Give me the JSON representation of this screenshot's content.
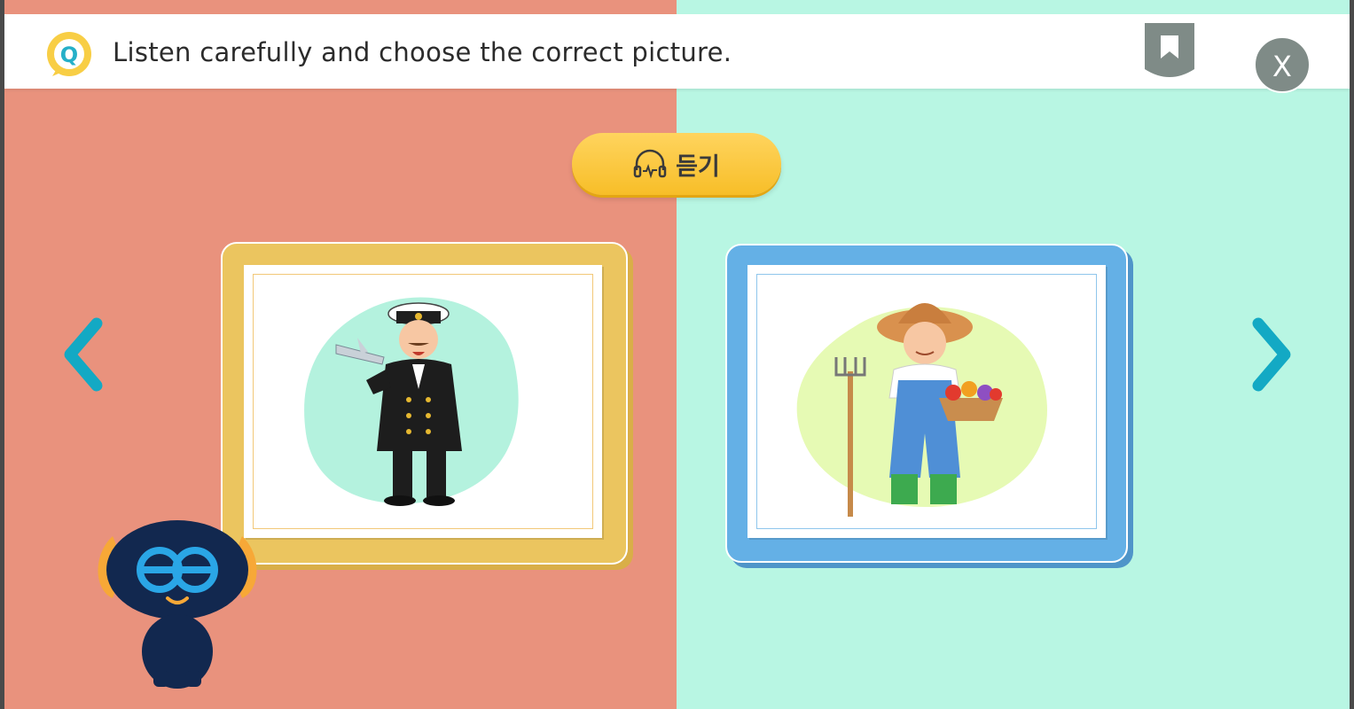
{
  "header": {
    "question_badge": "Q",
    "question_text": "Listen carefully and choose the correct picture.",
    "close_label": "X"
  },
  "listen_button": {
    "label": "듣기",
    "icon": "headphones-icon"
  },
  "options": [
    {
      "name": "pilot",
      "frame_color": "#EBC55F",
      "accent": "#F2C878"
    },
    {
      "name": "farmer",
      "frame_color": "#64B0E6",
      "accent": "#8FC6EC"
    }
  ],
  "navigation": {
    "prev_icon": "chevron-left-icon",
    "next_icon": "chevron-right-icon",
    "color": "#13A9C4"
  },
  "colors": {
    "left_background": "#E9927D",
    "right_background": "#B8F6E3",
    "button_yellow": "#FCC93A",
    "mascot": "#12284F"
  }
}
